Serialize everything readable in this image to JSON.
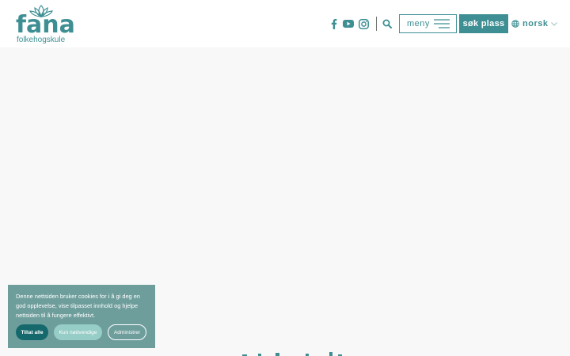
{
  "brand": {
    "logo_word": "fana",
    "logo_sub": "folkehogskule",
    "color": "#3e8f93"
  },
  "header": {
    "icons": [
      "facebook-icon",
      "youtube-icon",
      "instagram-icon",
      "search-icon"
    ],
    "menu_label": "meny",
    "apply_label": "søk plass",
    "language_label": "norsk"
  },
  "cookie": {
    "text": "Denne nettsiden bruker cookies for i å gi deg en god opplevelse, vise tilpasset innhold og hjelpe nettsiden til å fungere effektivt.",
    "allow_all": "Tillat alle",
    "necessary_only": "Kun nødvendige",
    "manage": "Administrer",
    "bg_color": "#6e9e9c"
  }
}
